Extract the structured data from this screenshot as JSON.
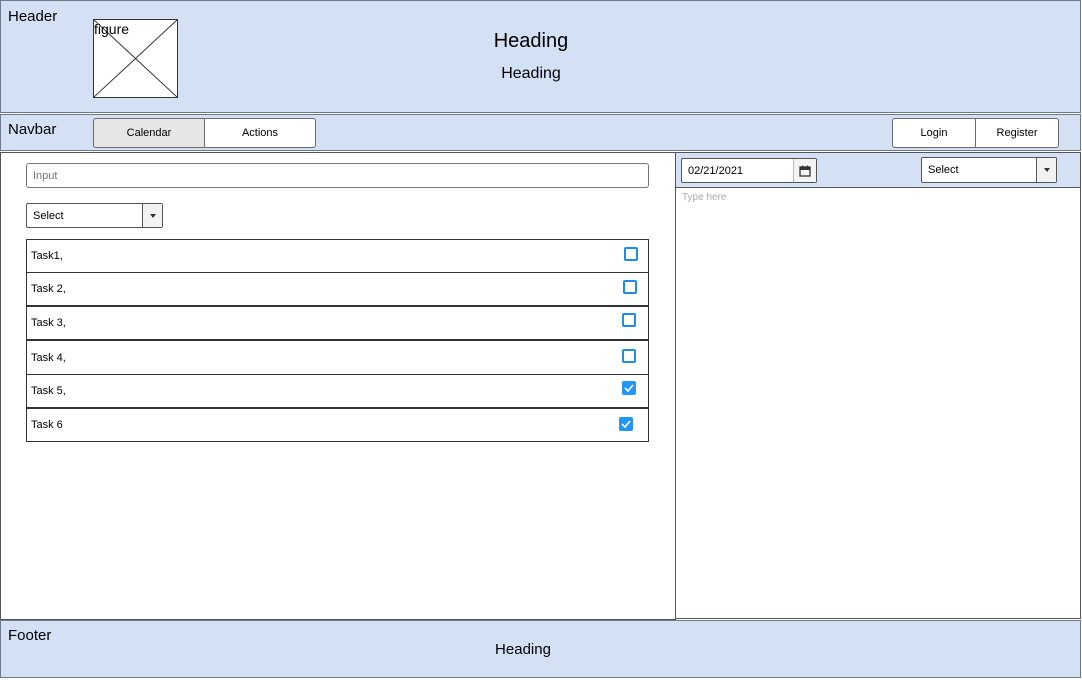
{
  "header": {
    "label": "Header",
    "figure_label": "figure",
    "heading": "Heading",
    "subheading": "Heading"
  },
  "navbar": {
    "label": "Navbar",
    "tabs": [
      {
        "label": "Calendar",
        "active": true
      },
      {
        "label": "Actions",
        "active": false
      }
    ],
    "login_label": "Login",
    "register_label": "Register"
  },
  "main": {
    "input_placeholder": "Input",
    "select_value": "Select",
    "tasks": [
      {
        "label": "Task1,",
        "checked": false
      },
      {
        "label": "Task 2,",
        "checked": false
      },
      {
        "label": "Task 3,",
        "checked": false
      },
      {
        "label": "Task 4,",
        "checked": false
      },
      {
        "label": "Task 5,",
        "checked": true
      },
      {
        "label": "Task 6",
        "checked": true
      }
    ]
  },
  "side": {
    "date_value": "02/21/2021",
    "select_value": "Select",
    "textarea_placeholder": "Type here"
  },
  "footer": {
    "label": "Footer",
    "heading": "Heading"
  },
  "colors": {
    "region_bg": "#d4e1f5",
    "checkbox_accent": "#2196f3"
  }
}
